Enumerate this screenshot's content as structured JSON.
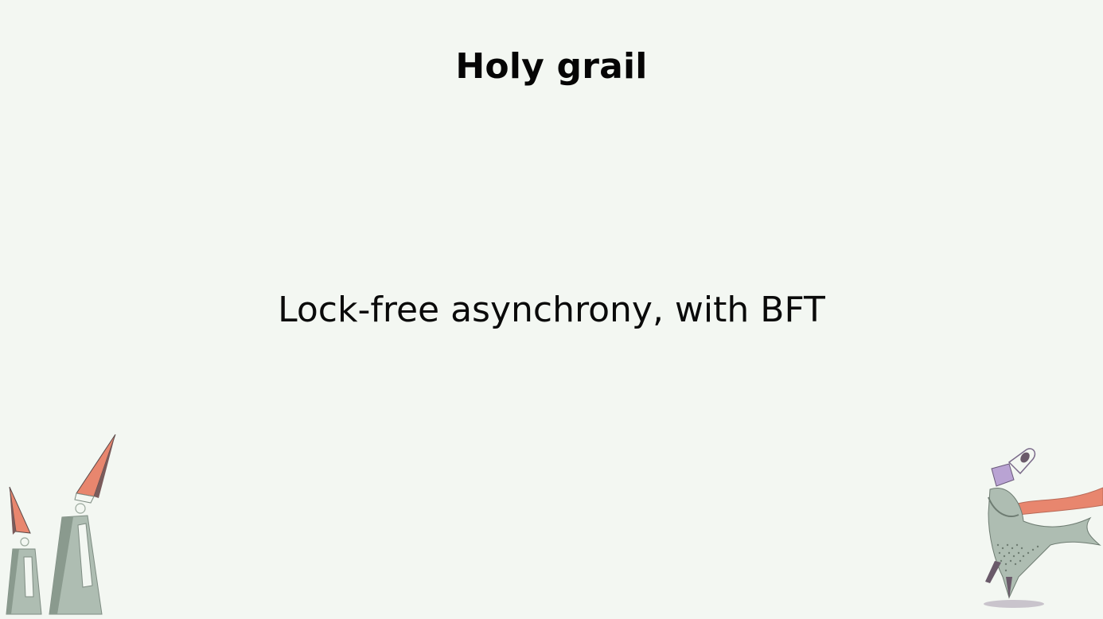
{
  "slide": {
    "title": "Holy grail",
    "body": "Lock-free asynchrony, with BFT"
  },
  "colors": {
    "background": "#f3f7f2",
    "text": "#050505",
    "figure_gray": "#aebdb2",
    "figure_coral": "#e8866e",
    "figure_lilac": "#b9a3d3"
  },
  "icons": {
    "left_illustration": "gnome-figures-illustration",
    "right_illustration": "running-figure-illustration"
  }
}
